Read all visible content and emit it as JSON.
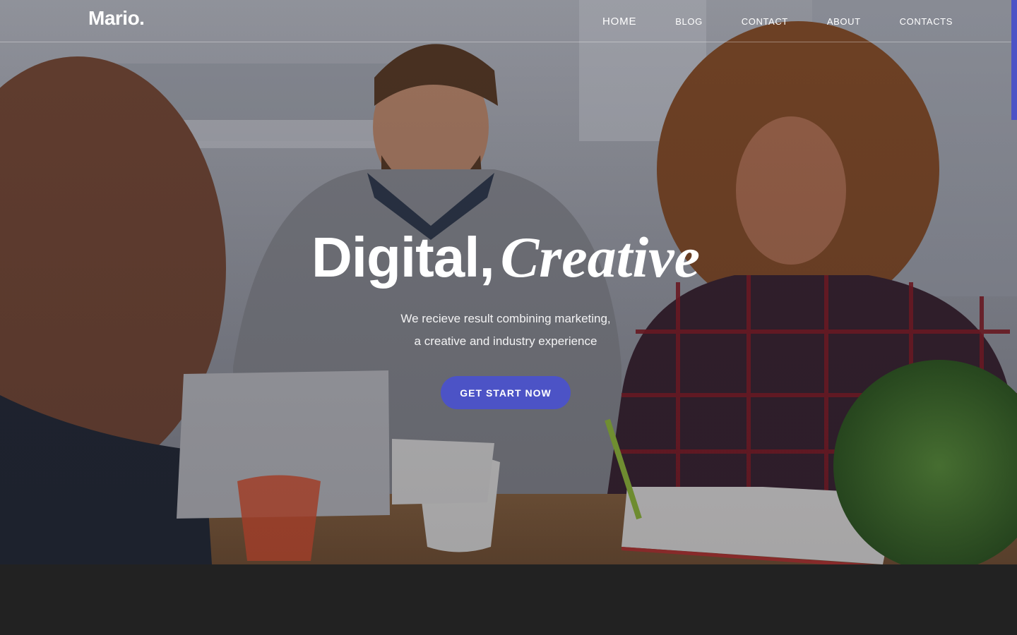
{
  "brand": {
    "logo": "Mario."
  },
  "nav": {
    "items": [
      {
        "label": "HOME",
        "active": true
      },
      {
        "label": "BLOG"
      },
      {
        "label": "CONTACT"
      },
      {
        "label": "ABOUT"
      },
      {
        "label": "CONTACTS"
      }
    ]
  },
  "hero": {
    "headline_strong": "Digital,",
    "headline_italic": "Creative",
    "subtitle_line1": "We recieve result combining marketing,",
    "subtitle_line2": "a creative and industry experience",
    "cta_label": "GET START NOW",
    "image_icon": "office-team-photo"
  },
  "colors": {
    "accent": "#4c53c6",
    "footer": "#222222",
    "text": "#ffffff"
  }
}
